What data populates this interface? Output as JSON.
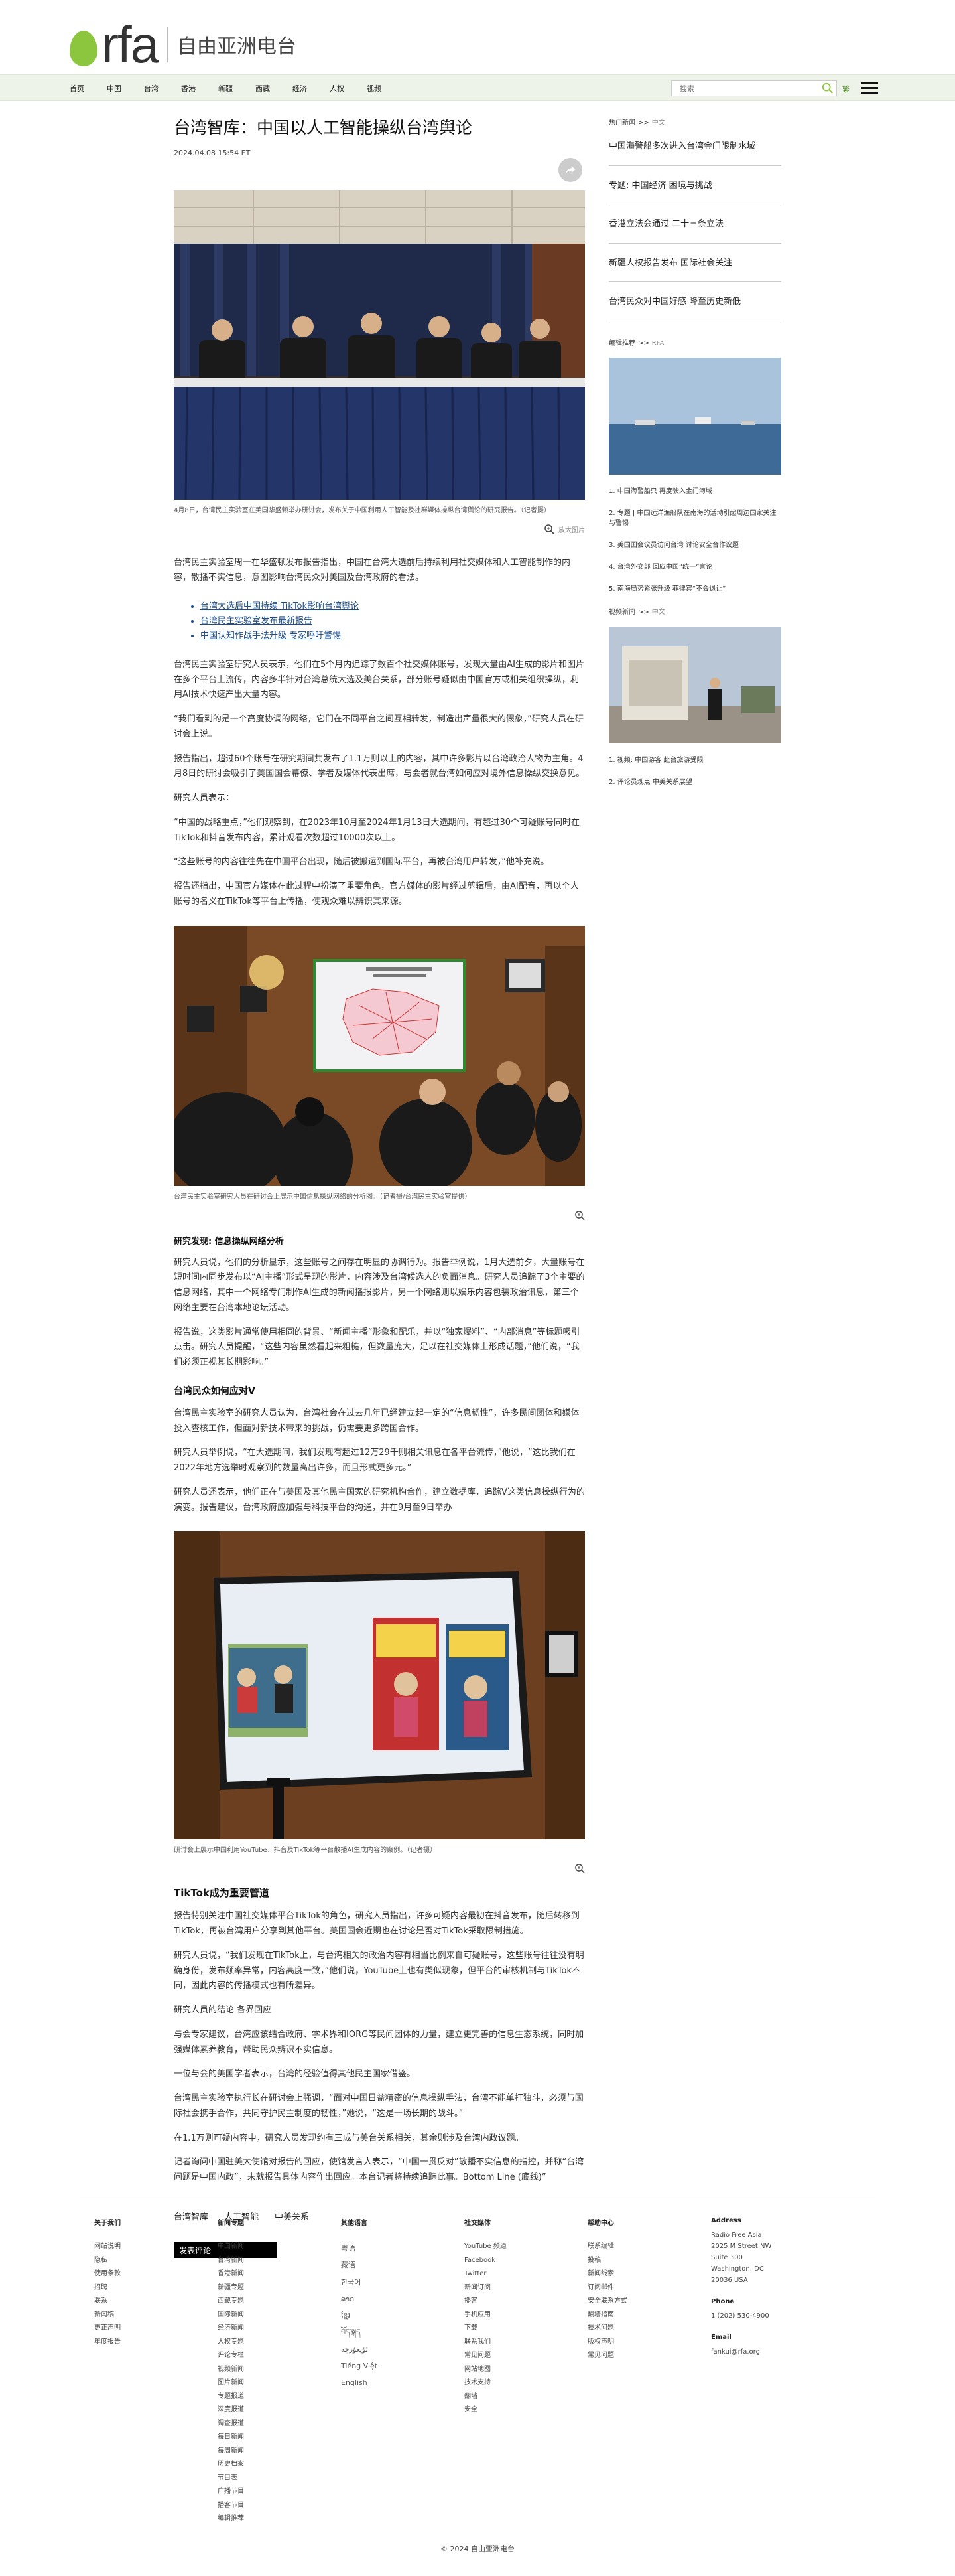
{
  "brand": {
    "name": "rfa",
    "chinese_name": "自由亚洲电台",
    "accent": "#8cc63f"
  },
  "nav": {
    "items": [
      "首页",
      "中国",
      "台湾",
      "香港",
      "新疆",
      "西藏",
      "经济",
      "人权",
      "视频"
    ],
    "search_placeholder": "搜索",
    "lang_label": "繁"
  },
  "article": {
    "title": "台湾智库：中国以人工智能操纵台湾舆论",
    "date": "2024.04.08 15:54 ET",
    "photo1_caption": "4月8日，台湾民主实验室在美国华盛顿举办研讨会，发布关于中国利用人工智能及社群媒体操纵台湾舆论的研究报告。（记者摄）",
    "enlarge": "放大图片",
    "intro": "台湾民主实验室周一在华盛顿发布报告指出，中国在台湾大选前后持续利用社交媒体和人工智能制作的内容，散播不实信息，意图影响台湾民众对美国及台湾政府的看法。",
    "related": [
      "台湾大选后中国持续 TikTok影响台湾舆论",
      "台湾民主实验室发布最新报告",
      "中国认知作战手法升级 专家呼吁警惕"
    ],
    "para1": "台湾民主实验室研究人员表示，他们在5个月内追踪了数百个社交媒体账号，发现大量由AI生成的影片和图片在多个平台上流传，内容多半针对台湾总统大选及美台关系，部分账号疑似由中国官方或相关组织操纵，利用AI技术快速产出大量内容。",
    "para2": "“我们看到的是一个高度协调的网络，它们在不同平台之间互相转发，制造出声量很大的假象，”研究人员在研讨会上说。",
    "para3": "报告指出，超过60个账号在研究期间共发布了1.1万则以上的内容，其中许多影片以台湾政治人物为主角。4月8日的研讨会吸引了美国国会幕僚、学者及媒体代表出席，与会者就台湾如何应对境外信息操纵交换意见。",
    "para4": "研究人员表示：",
    "para5": "“中国的战略重点，”他们观察到，在2023年10月至2024年1月13日大选期间，有超过30个可疑账号同时在TikTok和抖音发布内容，累计观看次数超过10000次以上。",
    "para6": "“这些账号的内容往往先在中国平台出现，随后被搬运到国际平台，再被台湾用户转发，”他补充说。",
    "para7": "报告还指出，中国官方媒体在此过程中扮演了重要角色，官方媒体的影片经过剪辑后，由AI配音，再以个人账号的名义在TikTok等平台上传播，使观众难以辨识其来源。",
    "photo2_caption": "台湾民主实验室研究人员在研讨会上展示中国信息操纵网络的分析图。（记者摄/台湾民主实验室提供）",
    "sub1": "研究发现: 信息操纵网络分析",
    "para8": "研究人员说，他们的分析显示，这些账号之间存在明显的协调行为。报告举例说，1月大选前夕，大量账号在短时间内同步发布以“AI主播”形式呈现的影片，内容涉及台湾候选人的负面消息。研究人员追踪了3个主要的信息网络，其中一个网络专门制作AI生成的新闻播报影片，另一个网络则以娱乐内容包装政治讯息，第三个网络主要在台湾本地论坛活动。",
    "para9": "报告说，这类影片通常使用相同的背景、“新闻主播”形象和配乐，并以“独家爆料”、“内部消息”等标题吸引点击。研究人员提醒，“这些内容虽然看起来粗糙，但数量庞大，足以在社交媒体上形成话题，”他们说，“我们必须正视其长期影响。”",
    "sub2": "台湾民众如何应对V",
    "para10": "台湾民主实验室的研究人员认为，台湾社会在过去几年已经建立起一定的“信息韧性”，许多民间团体和媒体投入查核工作，但面对新技术带来的挑战，仍需要更多跨国合作。",
    "para11": "研究人员举例说，“在大选期间，我们发现有超过12万29千则相关讯息在各平台流传，”他说，“这比我们在2022年地方选举时观察到的数量高出许多，而且形式更多元。”",
    "para12": "研究人员还表示，他们正在与美国及其他民主国家的研究机构合作，建立数据库，追踪V这类信息操纵行为的演变。报告建议，台湾政府应加强与科技平台的沟通，并在9月至9日举办",
    "photo3_caption": "研讨会上展示中国利用YouTube、抖音及TikTok等平台散播AI生成内容的案例。（记者摄）",
    "sub3": "TikTok成为重要管道",
    "para13": "报告特别关注中国社交媒体平台TikTok的角色，研究人员指出，许多可疑内容最初在抖音发布，随后转移到TikTok，再被台湾用户分享到其他平台。美国国会近期也在讨论是否对TikTok采取限制措施。",
    "para14": "研究人员说，“我们发现在TikTok上，与台湾相关的政治内容有相当比例来自可疑账号，这些账号往往没有明确身份，发布频率异常，内容高度一致，”他们说，YouTube上也有类似现象，但平台的审核机制与TikTok不同，因此内容的传播模式也有所差异。",
    "para15": "研究人员的结论 各界回应",
    "para16": "与会专家建议，台湾应该结合政府、学术界和IORG等民间团体的力量，建立更完善的信息生态系统，同时加强媒体素养教育，帮助民众辨识不实信息。",
    "para17": "一位与会的美国学者表示，台湾的经验值得其他民主国家借鉴。",
    "para18": "台湾民主实验室执行长在研讨会上强调，“面对中国日益精密的信息操纵手法，台湾不能单打独斗，必须与国际社会携手合作，共同守护民主制度的韧性，”她说，“这是一场长期的战斗。”",
    "para19": "在1.1万则可疑内容中，研究人员发现约有三成与美台关系相关，其余则涉及台湾内政议题。",
    "para20": "记者询问中国驻美大使馆对报告的回应，使馆发言人表示，“中国一贯反对”散播不实信息的指控，并称“台湾问题是中国内政”，未就报告具体内容作出回应。本台记者将持续追踪此事。Bottom Line (底线)”",
    "tags": [
      "台湾智库",
      "人工智能",
      "中美关系"
    ],
    "comment_label": "发表评论"
  },
  "sidebar": {
    "section1": {
      "head": "热门新闻",
      "source": "中文"
    },
    "items1": [
      "中国海警船多次进入台湾金门限制水域",
      "专题: 中国经济 困境与挑战",
      "香港立法会通过 二十三条立法",
      "新疆人权报告发布 国际社会关注",
      "台湾民众对中国好感 降至历史新低"
    ],
    "section2": {
      "head": "编辑推荐",
      "source": "RFA"
    },
    "list2": [
      "1. 中国海警船只 再度驶入金门海域",
      "2. 专题 | 中国远洋渔船队在南海的活动引起周边国家关注与警惕",
      "3. 美国国会议员访问台湾 讨论安全合作议题",
      "4. 台湾外交部 回应中国“统一”言论",
      "5. 南海局势紧张升级 菲律宾“不会退让”"
    ],
    "section3": {
      "head": "视频新闻",
      "source": "中文"
    },
    "list3": [
      "1. 视频: 中国游客 赴台旅游受限",
      "2. 评论员观点 中美关系展望"
    ]
  },
  "footer": {
    "cols": [
      {
        "head": "关于我们",
        "items": [
          "网站说明",
          "隐私",
          "使用条款",
          "招聘",
          "联系",
          "新闻稿",
          "更正声明",
          "年度报告"
        ]
      },
      {
        "head": "新闻专题",
        "items": [
          "中国新闻",
          "台湾新闻",
          "香港新闻",
          "新疆专题",
          "西藏专题",
          "国际新闻",
          "经济新闻",
          "人权专题",
          "评论专栏",
          "视频新闻",
          "图片新闻",
          "专题报道",
          "深度报道",
          "调查报道",
          "每日新闻",
          "每周新闻",
          "历史档案",
          "节目表",
          "广播节目",
          "播客节目",
          "编辑推荐"
        ]
      },
      {
        "head": "其他语言",
        "langs": [
          "粤语",
          "藏语",
          "한국어",
          "ລາວ",
          "ខ្មែរ",
          "བོད་སྐད",
          "ئۇيغۇرچە",
          "Tiếng Việt",
          "English"
        ]
      },
      {
        "head": "社交媒体",
        "items": [
          "YouTube 频道",
          "Facebook",
          "Twitter",
          "新闻订阅",
          "播客",
          "手机应用",
          "下载",
          "联系我们",
          "常见问题",
          "网站地图",
          "技术支持",
          "翻墙",
          "安全"
        ]
      },
      {
        "head": "帮助中心",
        "items": [
          "联系编辑",
          "投稿",
          "新闻线索",
          "订阅邮件",
          "安全联系方式",
          "翻墙指南",
          "技术问题",
          "版权声明",
          "常见问题"
        ]
      }
    ],
    "address": {
      "head": "Address",
      "lines": [
        "Radio Free Asia",
        "2025 M Street NW",
        "Suite 300",
        "Washington, DC",
        "20036 USA"
      ],
      "phone_head": "Phone",
      "phone": "1 (202) 530-4900",
      "email_head": "Email",
      "email": "fankui@rfa.org"
    },
    "copyright": "© 2024 自由亚洲电台"
  }
}
